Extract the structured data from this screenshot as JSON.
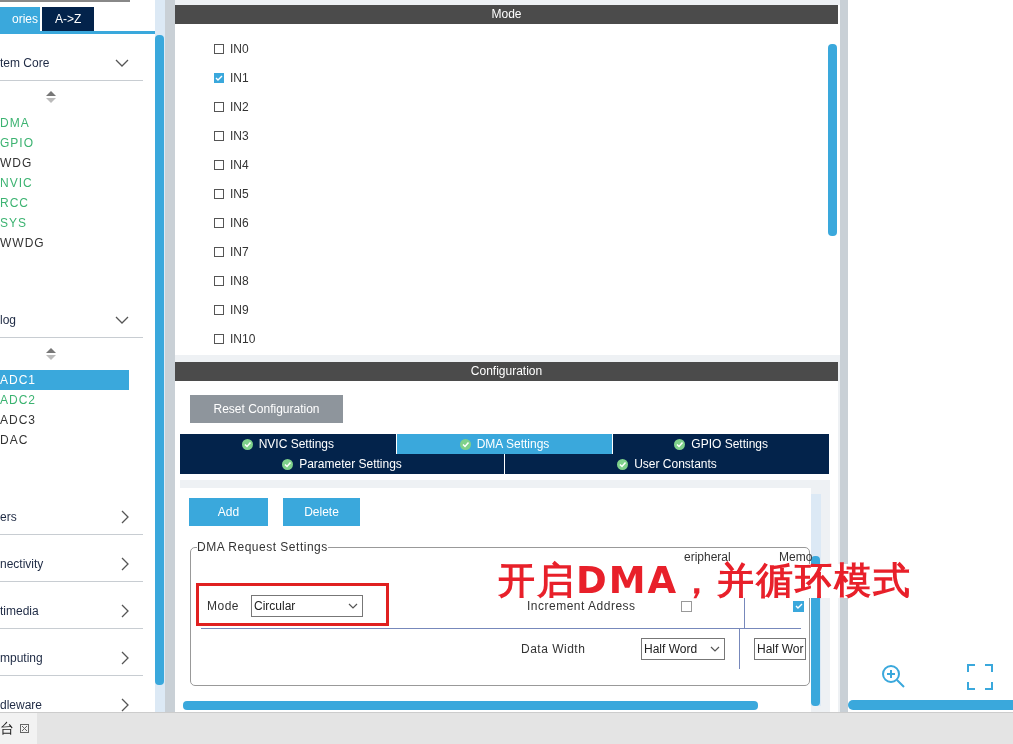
{
  "sidebar": {
    "tabs": [
      {
        "label": "ories",
        "selected": true
      },
      {
        "label": "A->Z",
        "selected": false
      }
    ],
    "groups": [
      {
        "label": "tem Core",
        "expanded": true,
        "items": [
          {
            "label": "DMA",
            "color": "#3cb371",
            "selected": false
          },
          {
            "label": "GPIO",
            "color": "#3cb371",
            "selected": false
          },
          {
            "label": "WDG",
            "color": "#333333",
            "selected": false
          },
          {
            "label": "NVIC",
            "color": "#3cb371",
            "selected": false
          },
          {
            "label": "RCC",
            "color": "#3cb371",
            "selected": false
          },
          {
            "label": "SYS",
            "color": "#3cb371",
            "selected": false
          },
          {
            "label": "WWDG",
            "color": "#333333",
            "selected": false
          }
        ]
      },
      {
        "label": "log",
        "expanded": true,
        "items": [
          {
            "label": "ADC1",
            "selected": true
          },
          {
            "label": "ADC2",
            "color": "#3cb371",
            "selected": false
          },
          {
            "label": "ADC3",
            "color": "#333333",
            "selected": false
          },
          {
            "label": "DAC",
            "color": "#333333",
            "selected": false
          }
        ]
      },
      {
        "label": "ers",
        "expanded": false
      },
      {
        "label": "nectivity",
        "expanded": false
      },
      {
        "label": "timedia",
        "expanded": false
      },
      {
        "label": "mputing",
        "expanded": false
      },
      {
        "label": "dleware",
        "expanded": false
      }
    ]
  },
  "mode_panel": {
    "title": "Mode",
    "channels": [
      {
        "label": "IN0",
        "checked": false
      },
      {
        "label": "IN1",
        "checked": true
      },
      {
        "label": "IN2",
        "checked": false
      },
      {
        "label": "IN3",
        "checked": false
      },
      {
        "label": "IN4",
        "checked": false
      },
      {
        "label": "IN5",
        "checked": false
      },
      {
        "label": "IN6",
        "checked": false
      },
      {
        "label": "IN7",
        "checked": false
      },
      {
        "label": "IN8",
        "checked": false
      },
      {
        "label": "IN9",
        "checked": false
      },
      {
        "label": "IN10",
        "checked": false
      }
    ]
  },
  "configuration": {
    "title": "Configuration",
    "reset_button": "Reset Configuration",
    "tab_rows": [
      [
        {
          "label": "NVIC Settings",
          "selected": false
        },
        {
          "label": "DMA Settings",
          "selected": true
        },
        {
          "label": "GPIO Settings",
          "selected": false
        }
      ],
      [
        {
          "label": "Parameter Settings",
          "selected": false
        },
        {
          "label": "User Constants",
          "selected": false
        }
      ]
    ],
    "buttons": [
      "Add",
      "Delete"
    ],
    "dma_request_settings": {
      "legend": "DMA Request Settings",
      "mode": {
        "label": "Mode",
        "value": "Circular"
      },
      "columns": [
        "eripheral",
        "Memo"
      ],
      "increment_address": {
        "label": "Increment Address",
        "peripheral_checked": false,
        "memory_checked": true
      },
      "data_width": {
        "label": "Data Width",
        "peripheral": "Half Word",
        "memory": "Half Wor"
      }
    }
  },
  "annotation": {
    "text": "开启DMA，并循环模式"
  },
  "bottom_tab": {
    "label": "台"
  }
}
